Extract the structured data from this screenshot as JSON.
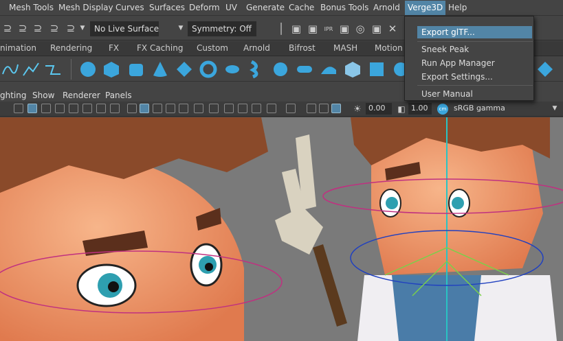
{
  "menubar": {
    "items": [
      "Mesh Tools",
      "Mesh Display",
      "Curves",
      "Surfaces",
      "Deform",
      "UV",
      "Generate",
      "Cache",
      "Bonus Tools",
      "Arnold",
      "Verge3D",
      "Help"
    ]
  },
  "statusline": {
    "live_surface": "No Live Surface",
    "symmetry": "Symmetry: Off"
  },
  "shelf_tabs": [
    "nimation",
    "Rendering",
    "FX",
    "FX Caching",
    "Custom",
    "Arnold",
    "Bifrost",
    "MASH",
    "Motion"
  ],
  "panel_menu": [
    "ghting",
    "Show",
    "Renderer",
    "Panels"
  ],
  "view_toolbar": {
    "exposure": "0.00",
    "gamma": "1.00",
    "color_space": "sRGB gamma"
  },
  "verge3d_menu": {
    "items": [
      "Export glTF...",
      "Sneek Peak",
      "Run App Manager",
      "Export Settings...",
      "User Manual"
    ]
  },
  "colors": {
    "accent": "#5285a6",
    "menu_bg": "#444444",
    "viewport_bg": "#7a7a7a"
  }
}
